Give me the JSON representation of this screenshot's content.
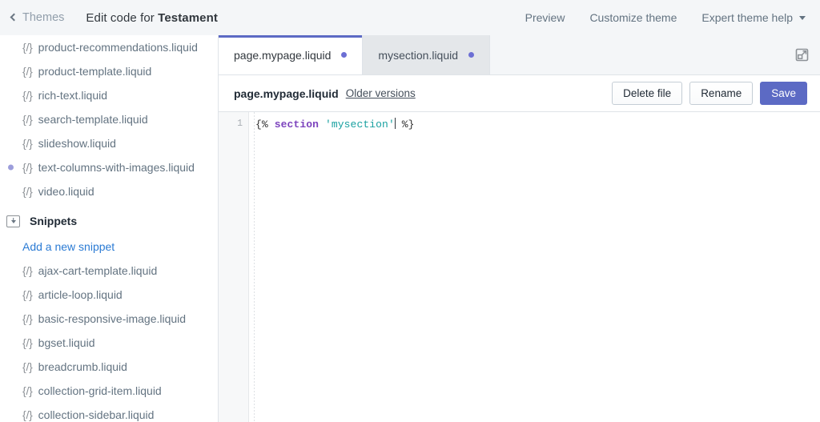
{
  "topbar": {
    "back_label": "Themes",
    "title_prefix": "Edit code for ",
    "title_theme": "Testament",
    "links": [
      {
        "label": "Preview",
        "caret": false
      },
      {
        "label": "Customize theme",
        "caret": false
      },
      {
        "label": "Expert theme help",
        "caret": true
      }
    ]
  },
  "sidebar": {
    "icon_glyph": "{/}",
    "top_files": [
      {
        "name": "product-recommendations.liquid",
        "modified": false
      },
      {
        "name": "product-template.liquid",
        "modified": false
      },
      {
        "name": "rich-text.liquid",
        "modified": false
      },
      {
        "name": "search-template.liquid",
        "modified": false
      },
      {
        "name": "slideshow.liquid",
        "modified": false
      },
      {
        "name": "text-columns-with-images.liquid",
        "modified": true
      },
      {
        "name": "video.liquid",
        "modified": false
      }
    ],
    "snippets_folder": {
      "label": "Snippets",
      "add_link": "Add a new snippet",
      "files": [
        {
          "name": "ajax-cart-template.liquid",
          "modified": false
        },
        {
          "name": "article-loop.liquid",
          "modified": false
        },
        {
          "name": "basic-responsive-image.liquid",
          "modified": false
        },
        {
          "name": "bgset.liquid",
          "modified": false
        },
        {
          "name": "breadcrumb.liquid",
          "modified": false
        },
        {
          "name": "collection-grid-item.liquid",
          "modified": false
        },
        {
          "name": "collection-sidebar.liquid",
          "modified": false
        }
      ]
    }
  },
  "editor_pane": {
    "tabs": [
      {
        "label": "page.mypage.liquid",
        "active": true,
        "modified": true
      },
      {
        "label": "mysection.liquid",
        "active": false,
        "modified": true
      }
    ],
    "expand_icon": "expand-icon",
    "file_header": {
      "filename": "page.mypage.liquid",
      "older_versions": "Older versions",
      "buttons": {
        "delete": "Delete file",
        "rename": "Rename",
        "save": "Save"
      }
    },
    "code": {
      "line_number": "1",
      "tokens": {
        "open": "{% ",
        "tag": "section",
        "space": " ",
        "string": "'mysection'",
        "close": " %}"
      }
    }
  },
  "colors": {
    "accent_purple": "#5c6ac4",
    "modified_dot": "#6c6fd4",
    "link_blue": "#2b7bd4",
    "tag_purple": "#7c43bd",
    "string_teal": "#18a0a0",
    "chrome_grey": "#f4f6f8",
    "border_grey": "#dfe3e8"
  }
}
